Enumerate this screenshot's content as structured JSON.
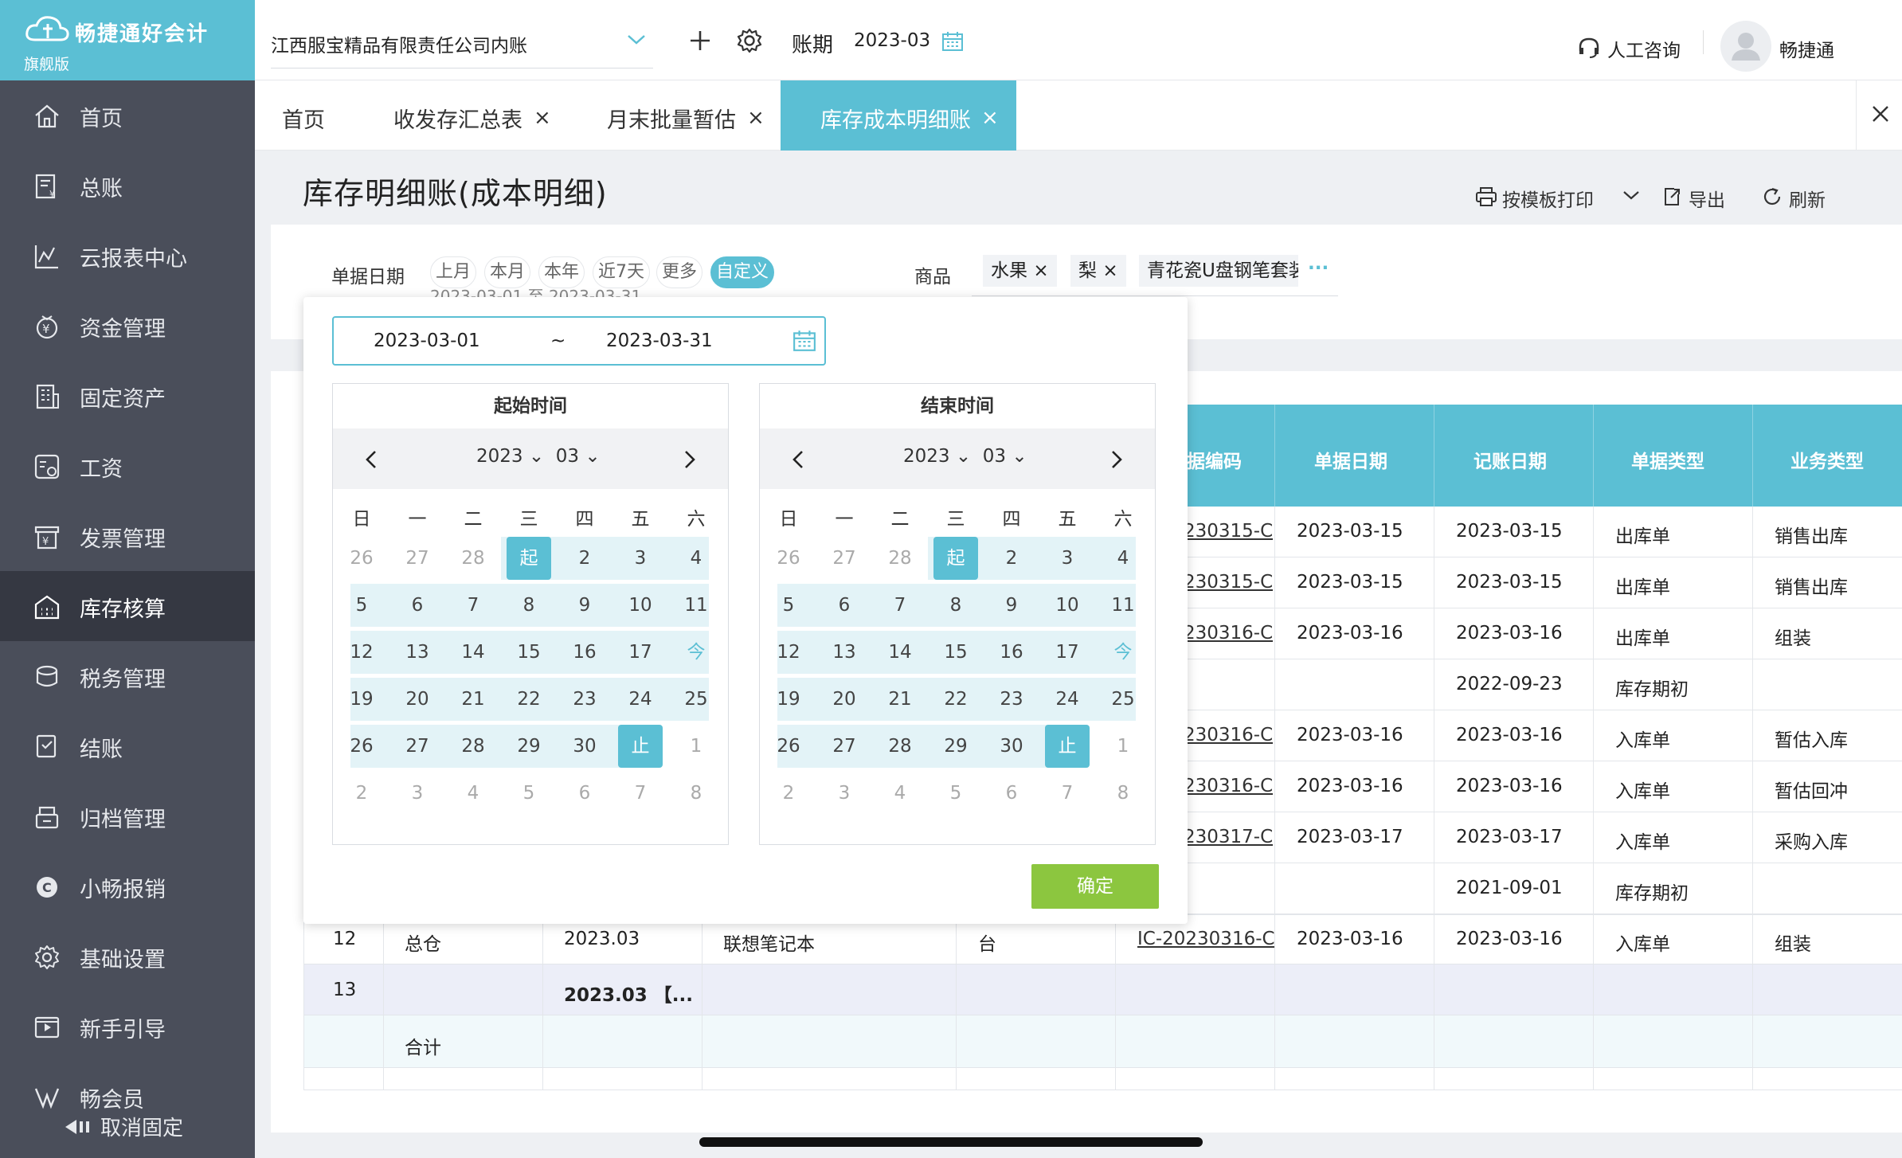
{
  "app": {
    "brand": "畅捷通好会计",
    "edition": "旗舰版"
  },
  "sidebar": {
    "items": [
      {
        "label": "首页",
        "icon": "home-icon"
      },
      {
        "label": "总账",
        "icon": "ledger-icon"
      },
      {
        "label": "云报表中心",
        "icon": "chart-icon"
      },
      {
        "label": "资金管理",
        "icon": "money-icon"
      },
      {
        "label": "固定资产",
        "icon": "building-icon"
      },
      {
        "label": "工资",
        "icon": "salary-icon"
      },
      {
        "label": "发票管理",
        "icon": "invoice-icon"
      },
      {
        "label": "库存核算",
        "icon": "warehouse-icon"
      },
      {
        "label": "税务管理",
        "icon": "tax-icon"
      },
      {
        "label": "结账",
        "icon": "checkout-icon"
      },
      {
        "label": "归档管理",
        "icon": "archive-icon"
      },
      {
        "label": "小畅报销",
        "icon": "reimburse-icon"
      },
      {
        "label": "基础设置",
        "icon": "gear-icon"
      },
      {
        "label": "新手引导",
        "icon": "guide-icon"
      },
      {
        "label": "畅会员",
        "icon": "member-icon"
      }
    ],
    "active_index": 7,
    "unpin_label": "取消固定"
  },
  "topbar": {
    "company": "江西服宝精品有限责任公司内账",
    "period_label": "账期",
    "period_value": "2023-03",
    "consult": "人工咨询",
    "user": "畅捷通"
  },
  "tabs": [
    {
      "label": "首页",
      "closable": false
    },
    {
      "label": "收发存汇总表",
      "closable": true
    },
    {
      "label": "月末批量暂估",
      "closable": true
    },
    {
      "label": "库存成本明细账",
      "closable": true,
      "active": true
    }
  ],
  "page": {
    "title": "库存明细账(成本明细)",
    "tools": {
      "print": "按模板打印",
      "export": "导出",
      "refresh": "刷新"
    }
  },
  "filters": {
    "date_label": "单据日期",
    "date_chips": [
      "上月",
      "本月",
      "本年",
      "近7天",
      "更多",
      "自定义"
    ],
    "date_range_text": "2023-03-01 至 2023-03-31",
    "goods_label": "商品",
    "goods_tags": [
      "水果",
      "梨",
      "青花瓷U盘钢笔套装"
    ],
    "goods_more": "···"
  },
  "datepicker": {
    "start": "2023-03-01",
    "sep": "~",
    "end": "2023-03-31",
    "start_title": "起始时间",
    "end_title": "结束时间",
    "year": "2023",
    "month": "03",
    "weekdays": [
      "日",
      "一",
      "二",
      "三",
      "四",
      "五",
      "六"
    ],
    "weeks": [
      [
        "26",
        "27",
        "28",
        "起",
        "2",
        "3",
        "4"
      ],
      [
        "5",
        "6",
        "7",
        "8",
        "9",
        "10",
        "11"
      ],
      [
        "12",
        "13",
        "14",
        "15",
        "16",
        "17",
        "今"
      ],
      [
        "19",
        "20",
        "21",
        "22",
        "23",
        "24",
        "25"
      ],
      [
        "26",
        "27",
        "28",
        "29",
        "30",
        "止",
        "1"
      ],
      [
        "2",
        "3",
        "4",
        "5",
        "6",
        "7",
        "8"
      ]
    ],
    "confirm": "确定"
  },
  "table": {
    "headers": [
      "据编码",
      "单据日期",
      "记账日期",
      "单据类型",
      "业务类型"
    ],
    "rows": [
      {
        "code": "230315-C",
        "doc_date": "2023-03-15",
        "post_date": "2023-03-15",
        "doc_type": "出库单",
        "biz": "销售出库"
      },
      {
        "code": "230315-C",
        "doc_date": "2023-03-15",
        "post_date": "2023-03-15",
        "doc_type": "出库单",
        "biz": "销售出库"
      },
      {
        "code": "230316-C",
        "doc_date": "2023-03-16",
        "post_date": "2023-03-16",
        "doc_type": "出库单",
        "biz": "组装"
      },
      {
        "code": "",
        "doc_date": "",
        "post_date": "2022-09-23",
        "doc_type": "库存期初",
        "biz": ""
      },
      {
        "code": "230316-C",
        "doc_date": "2023-03-16",
        "post_date": "2023-03-16",
        "doc_type": "入库单",
        "biz": "暂估入库"
      },
      {
        "code": "230316-C",
        "doc_date": "2023-03-16",
        "post_date": "2023-03-16",
        "doc_type": "入库单",
        "biz": "暂估回冲"
      },
      {
        "code": "230317-C",
        "doc_date": "2023-03-17",
        "post_date": "2023-03-17",
        "doc_type": "入库单",
        "biz": "采购入库"
      },
      {
        "code": "",
        "doc_date": "",
        "post_date": "2021-09-01",
        "doc_type": "库存期初",
        "biz": ""
      }
    ],
    "row12": {
      "no": "12",
      "warehouse": "总仓",
      "period": "2023.03",
      "goods": "联想笔记本",
      "unit": "台",
      "code": "IC-20230316-C",
      "doc_date": "2023-03-16",
      "post_date": "2023-03-16",
      "doc_type": "入库单",
      "biz": "组装"
    },
    "row13": {
      "no": "13",
      "period": "2023.03 【..."
    },
    "total_label": "合计"
  }
}
